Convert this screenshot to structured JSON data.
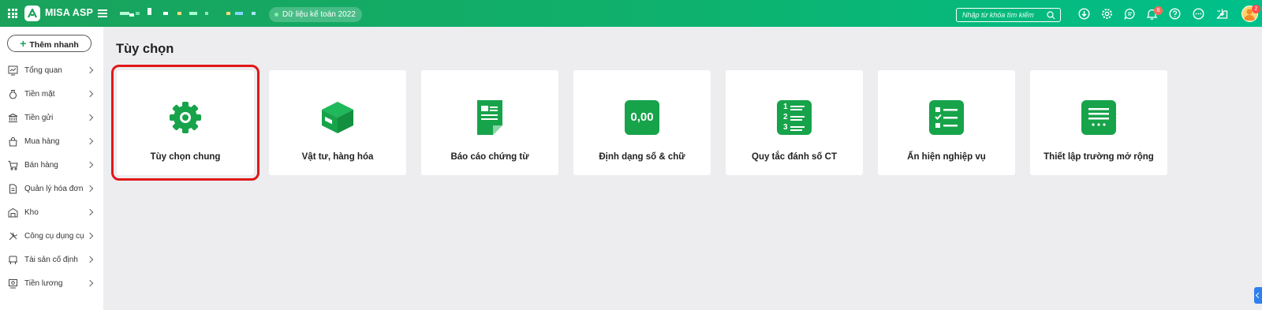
{
  "topbar": {
    "brand": "MISA ASP",
    "data_badge": "Dữ liệu kế toán 2022",
    "search_placeholder": "Nhập từ khóa tìm kiếm",
    "notification_count": "6",
    "avatar_count": "2",
    "accent_color": "#1aa25b",
    "icons": [
      "apps-grid-icon",
      "menu-icon",
      "download-icon",
      "gear-icon",
      "chat-icon",
      "bell-icon",
      "help-icon",
      "more-icon",
      "inbox-icon"
    ]
  },
  "sidebar": {
    "quick_add": "Thêm nhanh",
    "items": [
      {
        "label": "Tổng quan",
        "icon": "dashboard-icon"
      },
      {
        "label": "Tiền mặt",
        "icon": "money-bag-icon"
      },
      {
        "label": "Tiền gửi",
        "icon": "bank-icon"
      },
      {
        "label": "Mua hàng",
        "icon": "shopping-bag-icon"
      },
      {
        "label": "Bán hàng",
        "icon": "cart-icon"
      },
      {
        "label": "Quản lý hóa đơn",
        "icon": "invoice-icon"
      },
      {
        "label": "Kho",
        "icon": "warehouse-icon"
      },
      {
        "label": "Công cụ dụng cụ",
        "icon": "tools-icon"
      },
      {
        "label": "Tài sản cố định",
        "icon": "asset-icon"
      },
      {
        "label": "Tiền lương",
        "icon": "salary-icon"
      }
    ]
  },
  "main": {
    "title": "Tùy chọn",
    "cards": [
      {
        "label": "Tùy chọn chung",
        "icon": "gear-icon",
        "selected": true
      },
      {
        "label": "Vật tư, hàng hóa",
        "icon": "box-icon"
      },
      {
        "label": "Báo cáo chứng từ",
        "icon": "document-icon"
      },
      {
        "label": "Định dạng số & chữ",
        "icon": "number-format-icon",
        "icon_text": "0,00"
      },
      {
        "label": "Quy tắc đánh số CT",
        "icon": "numbered-list-icon",
        "icon_digits": [
          "1",
          "2",
          "3"
        ]
      },
      {
        "label": "Ẩn hiện nghiệp vụ",
        "icon": "checklist-icon"
      },
      {
        "label": "Thiết lập trường mở rộng",
        "icon": "extended-fields-icon"
      }
    ]
  }
}
